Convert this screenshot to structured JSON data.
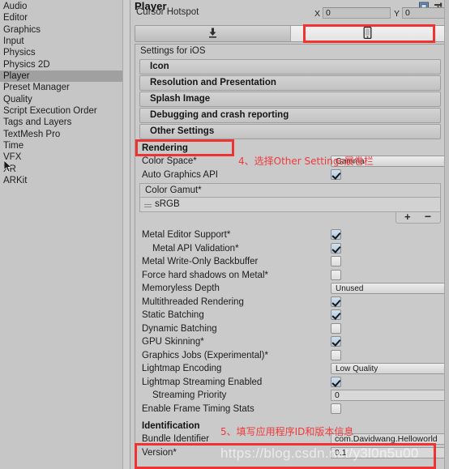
{
  "window": {
    "title": "Player",
    "icons": [
      {
        "name": "preset-icon"
      },
      {
        "name": "settings-menu-icon"
      }
    ]
  },
  "sidebar": {
    "items": [
      {
        "label": "Audio",
        "selected": false
      },
      {
        "label": "Editor",
        "selected": false
      },
      {
        "label": "Graphics",
        "selected": false
      },
      {
        "label": "Input",
        "selected": false
      },
      {
        "label": "Physics",
        "selected": false
      },
      {
        "label": "Physics 2D",
        "selected": false
      },
      {
        "label": "Player",
        "selected": true
      },
      {
        "label": "Preset Manager",
        "selected": false
      },
      {
        "label": "Quality",
        "selected": false
      },
      {
        "label": "Script Execution Order",
        "selected": false
      },
      {
        "label": "Tags and Layers",
        "selected": false
      },
      {
        "label": "TextMesh Pro",
        "selected": false
      },
      {
        "label": "Time",
        "selected": false
      },
      {
        "label": "VFX",
        "selected": false
      },
      {
        "label": "XR",
        "selected": false
      },
      {
        "label": "ARKit",
        "selected": false
      }
    ]
  },
  "cursor_hotspot": {
    "label": "Cursor Hotspot",
    "x_axis": "X",
    "x_value": "0",
    "y_axis": "Y",
    "y_value": "0"
  },
  "platform_tabs": [
    {
      "name": "standalone-tab",
      "icon": "download-icon",
      "active": false
    },
    {
      "name": "ios-tab",
      "icon": "mobile-phone-icon",
      "active": true
    }
  ],
  "settings": {
    "header": "Settings for iOS",
    "foldouts": [
      {
        "label": "Icon",
        "expanded": false
      },
      {
        "label": "Resolution and Presentation",
        "expanded": false
      },
      {
        "label": "Splash Image",
        "expanded": false
      },
      {
        "label": "Debugging and crash reporting",
        "expanded": false
      },
      {
        "label": "Other Settings",
        "expanded": true
      }
    ],
    "rendering": {
      "title": "Rendering",
      "color_space": {
        "label": "Color Space*",
        "value": "Gamma"
      },
      "auto_graphics_api": {
        "label": "Auto Graphics API",
        "checked": true
      },
      "color_gamut": {
        "label": "Color Gamut*",
        "items": [
          "sRGB"
        ],
        "add_label": "+",
        "remove_label": "−"
      },
      "toggles": [
        {
          "label": "Metal Editor Support*",
          "checked": true,
          "indent": false
        },
        {
          "label": "Metal API Validation*",
          "checked": true,
          "indent": true
        },
        {
          "label": "Metal Write-Only Backbuffer",
          "checked": false,
          "indent": false
        },
        {
          "label": "Force hard shadows on Metal*",
          "checked": false,
          "indent": false
        }
      ],
      "memoryless_depth": {
        "label": "Memoryless Depth",
        "value": "Unused"
      },
      "toggles2": [
        {
          "label": "Multithreaded Rendering",
          "checked": true,
          "indent": false
        },
        {
          "label": "Static Batching",
          "checked": true,
          "indent": false
        },
        {
          "label": "Dynamic Batching",
          "checked": false,
          "indent": false
        },
        {
          "label": "GPU Skinning*",
          "checked": true,
          "indent": false
        },
        {
          "label": "Graphics Jobs (Experimental)*",
          "checked": false,
          "indent": false
        }
      ],
      "lightmap_encoding": {
        "label": "Lightmap Encoding",
        "value": "Low Quality"
      },
      "lightmap_streaming": {
        "label": "Lightmap Streaming Enabled",
        "checked": true
      },
      "streaming_priority": {
        "label": "Streaming Priority",
        "value": "0"
      },
      "frame_timing": {
        "label": "Enable Frame Timing Stats",
        "checked": false
      }
    },
    "identification": {
      "title": "Identification",
      "bundle_identifier": {
        "label": "Bundle Identifier",
        "value": "com.Davidwang.Helloworld"
      },
      "version": {
        "label": "Version*",
        "value": "0.1"
      }
    }
  },
  "annotations": [
    {
      "name": "annotation-step-4",
      "text": "4、选择Other Settings展卷栏"
    },
    {
      "name": "annotation-step-5",
      "text": "5、填写应用程序ID和版本信息"
    }
  ],
  "watermark": {
    "text": "https://blog.csdn.net/y3l0n5u00"
  },
  "colors": {
    "annotation_red": "#ef3232",
    "panel_bg": "#c9c9c9",
    "selection": "#a0a0a0",
    "checkbox_on": "#aec7dd"
  }
}
